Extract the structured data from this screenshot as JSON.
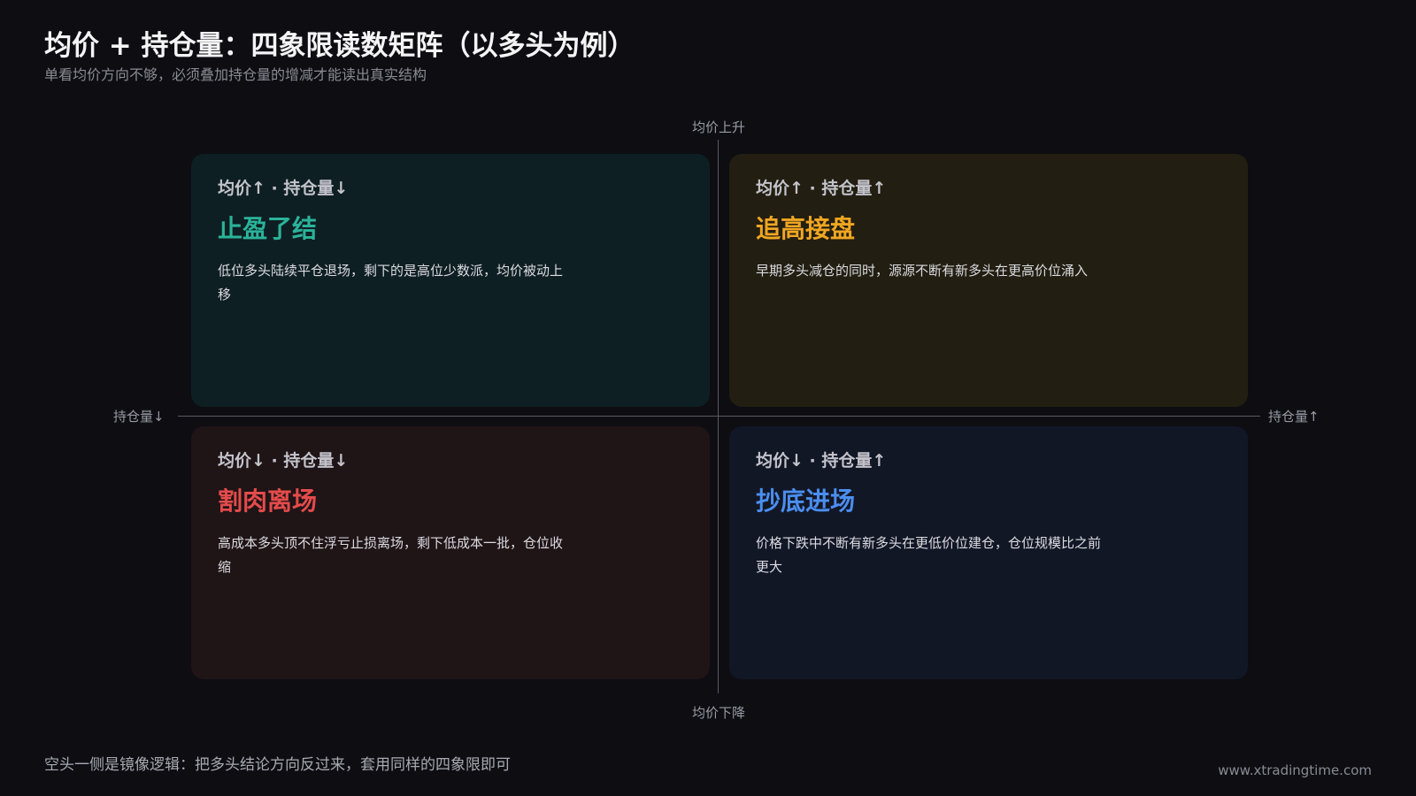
{
  "header": {
    "title": "均价 + 持仓量：四象限读数矩阵（以多头为例）",
    "subtitle": "单看均价方向不够，必须叠加持仓量的增减才能读出真实结构"
  },
  "axes": {
    "top": "均价上升",
    "bottom": "均价下降",
    "left": "持仓量↓",
    "right": "持仓量↑"
  },
  "quadrants": {
    "top_left": {
      "tag": "均价↑ · 持仓量↓",
      "name": "止盈了结",
      "desc": "低位多头陆续平仓退场，剩下的是高位少数派，均价被动上移",
      "color": "#2bb39a"
    },
    "top_right": {
      "tag": "均价↑ · 持仓量↑",
      "name": "追高接盘",
      "desc": "早期多头减仓的同时，源源不断有新多头在更高价位涌入",
      "color": "#f0a622"
    },
    "bottom_left": {
      "tag": "均价↓ · 持仓量↓",
      "name": "割肉离场",
      "desc": "高成本多头顶不住浮亏止损离场，剩下低成本一批，仓位收缩",
      "color": "#e44b4b"
    },
    "bottom_right": {
      "tag": "均价↓ · 持仓量↑",
      "name": "抄底进场",
      "desc": "价格下跌中不断有新多头在更低价位建仓，仓位规模比之前更大",
      "color": "#4b8ef0"
    }
  },
  "footer": {
    "note": "空头一侧是镜像逻辑：把多头结论方向反过来，套用同样的四象限即可",
    "url": "www.xtradingtime.com"
  }
}
